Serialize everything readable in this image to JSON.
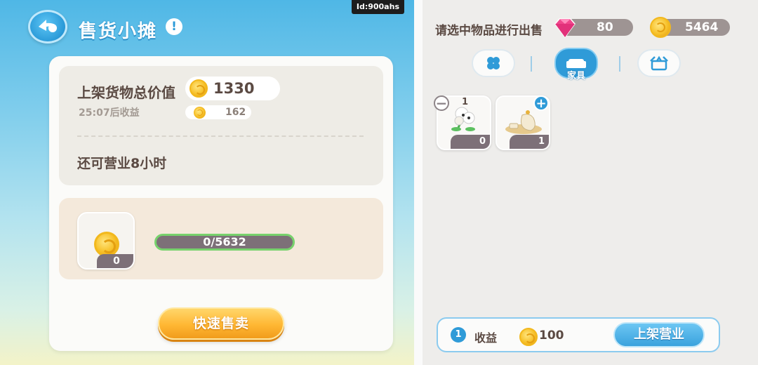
{
  "header": {
    "id_tag": "Id:900ahs",
    "title": "售货小摊",
    "info_icon": "info-icon"
  },
  "summary": {
    "total_label": "上架货物总价值",
    "total_value": "1330",
    "timer_label": "25:07后收益",
    "timer_value": "162",
    "hours_label": "还可营业8小时"
  },
  "sell": {
    "slot_count": "0",
    "progress_text": "0/5632",
    "progress_fraction": 0,
    "quick_sell_label": "快速售卖"
  },
  "right": {
    "prompt": "请选中物品进行出售",
    "gems": "80",
    "coins": "5464",
    "tabs": [
      {
        "icon": "clover-icon",
        "label": ""
      },
      {
        "icon": "sofa-icon",
        "label": "家具",
        "active": true
      },
      {
        "icon": "box-icon",
        "label": ""
      }
    ],
    "items": [
      {
        "name": "flower-vase",
        "selected": "1",
        "count": "0"
      },
      {
        "name": "tea-set",
        "count": "1"
      }
    ],
    "bottom": {
      "selected_count": "1",
      "income_label": "收益",
      "income_value": "100",
      "list_button": "上架营业"
    }
  },
  "colors": {
    "accent_blue": "#2f9bd8",
    "gold": "#f7c12a",
    "progress_border": "#77d26c",
    "text_brown": "#5b4a43"
  }
}
